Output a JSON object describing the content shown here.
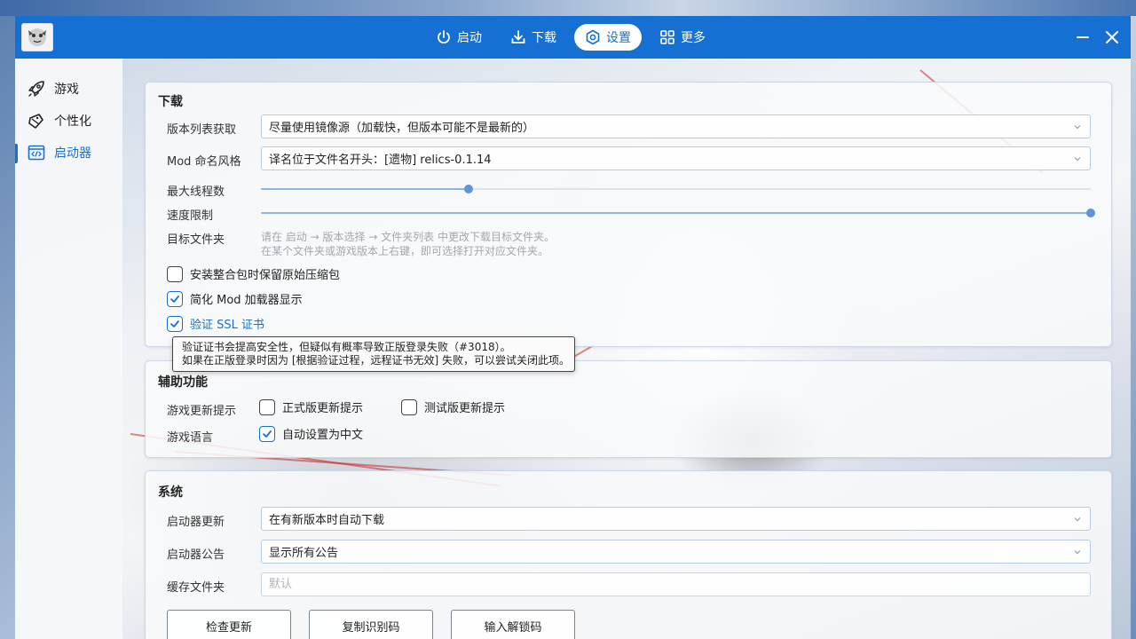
{
  "nav": {
    "launch": "启动",
    "download": "下载",
    "settings": "设置",
    "more": "更多",
    "active": "settings"
  },
  "sidebar": {
    "items": [
      {
        "label": "游戏",
        "icon": "rocket-icon"
      },
      {
        "label": "个性化",
        "icon": "palette-icon"
      },
      {
        "label": "启动器",
        "icon": "code-window-icon"
      }
    ],
    "active_index": 2
  },
  "download": {
    "title": "下载",
    "version_list_label": "版本列表获取",
    "version_list_value": "尽量使用镜像源（加载快，但版本可能不是最新的）",
    "mod_naming_label": "Mod 命名风格",
    "mod_naming_value": "译名位于文件名开头：[遗物] relics-0.1.14",
    "max_threads_label": "最大线程数",
    "max_threads_fraction": 0.25,
    "speed_limit_label": "速度限制",
    "speed_limit_fraction": 1.0,
    "target_folder_label": "目标文件夹",
    "target_folder_hint1": "请在 启动 → 版本选择 → 文件夹列表 中更改下载目标文件夹。",
    "target_folder_hint2": "在某个文件夹或游戏版本上右键，即可选择打开对应文件夹。",
    "keep_archive_label": "安装整合包时保留原始压缩包",
    "keep_archive_checked": false,
    "simplify_mod_label": "简化 Mod 加载器显示",
    "simplify_mod_checked": true,
    "verify_ssl_label": "验证 SSL 证书",
    "verify_ssl_checked": true,
    "tooltip_line1": "验证证书会提高安全性，但疑似有概率导致正版登录失败（#3018）。",
    "tooltip_line2": "如果在正版登录时因为 [根据验证过程，远程证书无效] 失败，可以尝试关闭此项。"
  },
  "assist": {
    "title": "辅助功能",
    "update_hint_label": "游戏更新提示",
    "release_update_label": "正式版更新提示",
    "release_update_checked": false,
    "snapshot_update_label": "测试版更新提示",
    "snapshot_update_checked": false,
    "language_label": "游戏语言",
    "auto_chinese_label": "自动设置为中文",
    "auto_chinese_checked": true
  },
  "system": {
    "title": "系统",
    "launcher_update_label": "启动器更新",
    "launcher_update_value": "在有新版本时自动下载",
    "announcement_label": "启动器公告",
    "announcement_value": "显示所有公告",
    "cache_folder_label": "缓存文件夹",
    "cache_folder_placeholder": "默认",
    "check_update_button": "检查更新",
    "copy_id_button": "复制识别码",
    "unlock_code_button": "输入解锁码"
  },
  "colors": {
    "accent": "#1670d3",
    "checkbox_accent": "#1670d3"
  }
}
